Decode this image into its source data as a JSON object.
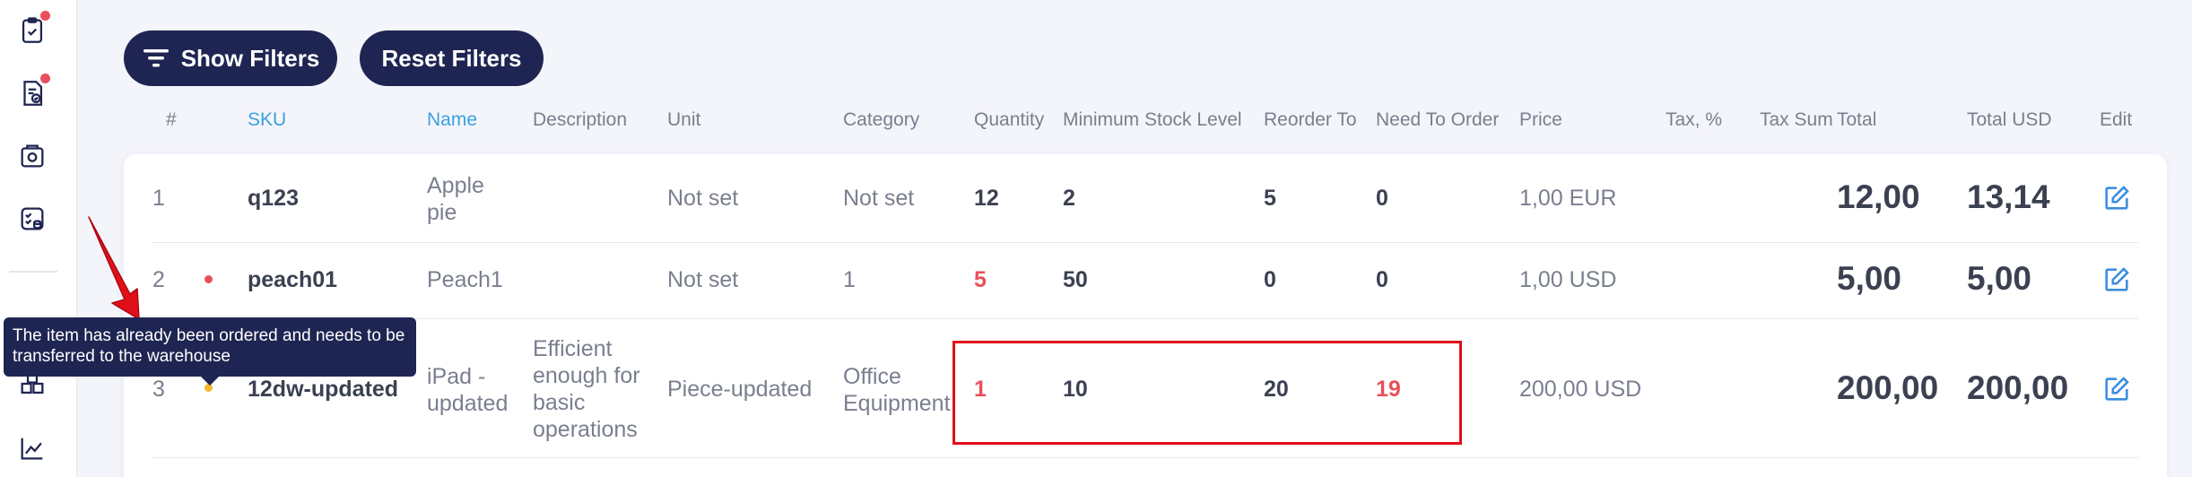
{
  "filters": {
    "show_label": "Show Filters",
    "reset_label": "Reset Filters"
  },
  "table": {
    "headers": {
      "num": "#",
      "sku": "SKU",
      "name": "Name",
      "description": "Description",
      "unit": "Unit",
      "category": "Category",
      "quantity": "Quantity",
      "min_stock": "Minimum Stock Level",
      "reorder_to": "Reorder To",
      "need_to_order": "Need To Order",
      "price": "Price",
      "tax": "Tax, %",
      "tax_sum": "Tax Sum",
      "total": "Total",
      "total_usd": "Total USD",
      "edit": "Edit"
    },
    "rows": [
      {
        "num": "1",
        "sku": "q123",
        "name": "Apple pie",
        "description": "",
        "unit": "Not set",
        "category": "Not set",
        "quantity": "12",
        "min_stock": "2",
        "reorder_to": "5",
        "need_to_order": "0",
        "price": "1,00 EUR",
        "total": "12,00",
        "total_usd": "13,14"
      },
      {
        "num": "2",
        "sku": "peach01",
        "name": "Peach1",
        "description": "",
        "unit": "Not set",
        "category": "1",
        "quantity": "5",
        "min_stock": "50",
        "reorder_to": "0",
        "need_to_order": "0",
        "price": "1,00 USD",
        "total": "5,00",
        "total_usd": "5,00",
        "status_color": "#e8505b"
      },
      {
        "num": "3",
        "sku": "12dw-updated",
        "name": "iPad - updated",
        "description": "Efficient enough for basic operations",
        "unit": "Piece-updated",
        "category": "Office Equipment",
        "quantity": "1",
        "min_stock": "10",
        "reorder_to": "20",
        "need_to_order": "19",
        "price": "200,00 USD",
        "total": "200,00",
        "total_usd": "200,00",
        "status_color": "#f5b82e"
      }
    ]
  },
  "tooltip": {
    "text": "The item has already been ordered and needs to be transferred to the warehouse"
  },
  "colors": {
    "navy": "#1f2552",
    "accent": "#3aa0e0",
    "danger": "#e8505b",
    "annotation": "#e0101a"
  }
}
